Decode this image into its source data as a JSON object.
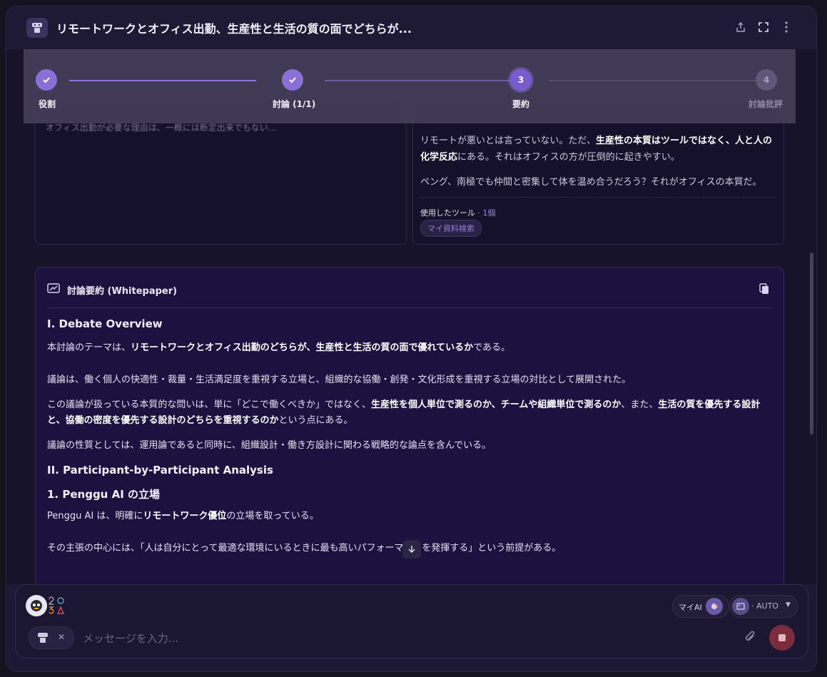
{
  "header": {
    "title": "リモートワークとオフィス出勤、生産性と生活の質の面でどちらが..."
  },
  "stepper": {
    "steps": [
      {
        "label": "役割",
        "state": "done"
      },
      {
        "label": "討論 (1/1)",
        "state": "done"
      },
      {
        "label": "要約",
        "number": "3",
        "state": "active"
      },
      {
        "label": "討論批評",
        "number": "4",
        "state": "pending"
      }
    ]
  },
  "left_panel": {
    "text_blurred": "オフィス出勤が必要な理由は、一概には断定出来でもない…"
  },
  "right_panel": {
    "para1_pre": "リモートが悪いとは言っていない。ただ、",
    "para1_bold": "生産性の本質はツールではなく、人と人の化学反応",
    "para1_post": "にある。それはオフィスの方が圧倒的に起きやすい。",
    "para2": "ペング、南極でも仲間と密集して体を温め合うだろう？それがオフィスの本質だ。",
    "tools_label": "使用したツール",
    "tools_count": "1個",
    "tool_chip": "マイ資料検索"
  },
  "summary": {
    "title": "討論要約 (Whitepaper)",
    "h1": "I. Debate Overview",
    "p1_pre": "本討論のテーマは、",
    "p1_bold": "リモートワークとオフィス出勤のどちらが、生産性と生活の質の面で優れているか",
    "p1_post": "である。",
    "p2": "議論は、働く個人の快適性・裁量・生活満足度を重視する立場と、組織的な協働・創発・文化形成を重視する立場の対比として展開された。",
    "p3_a": "この議論が扱っている本質的な問いは、単に「どこで働くべきか」ではなく、",
    "p3_b": "生産性を個人単位で測るのか、チームや組織単位で測るのか",
    "p3_c": "、また、",
    "p3_d": "生活の質を優先する設計と、協働の密度を優先する設計のどちらを重視するのか",
    "p3_e": "という点にある。",
    "p4": "議論の性質としては、運用論であると同時に、組織設計・働き方設計に関わる戦略的な論点を含んでいる。",
    "h2": "II. Participant-by-Participant Analysis",
    "h3": "1. Penggu AI の立場",
    "p5_pre": "Penggu AI は、明確に",
    "p5_bold": "リモートワーク優位",
    "p5_post": "の立場を取っている。",
    "p6": "その主張の中心には、「人は自分にとって最適な環境にいるときに最も高いパフォーマンスを発揮する」という前提がある。"
  },
  "composer": {
    "placeholder": "メッセージを入力...",
    "my_ai_label": "マイAI",
    "auto_label": "· AUTO"
  }
}
